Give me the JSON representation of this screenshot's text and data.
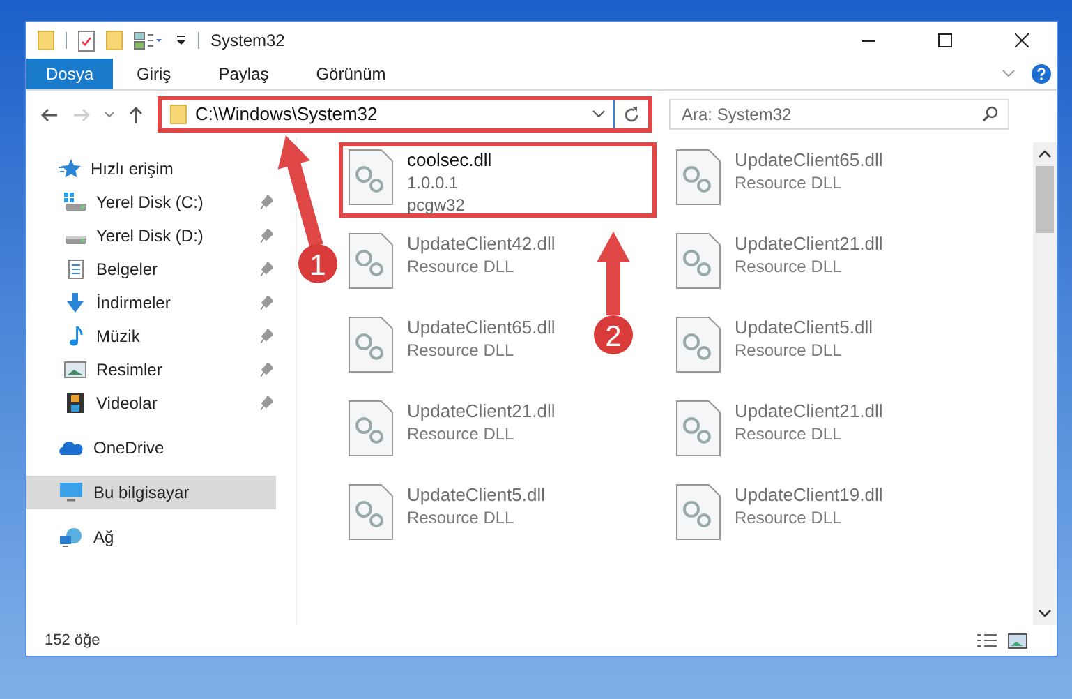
{
  "window": {
    "title": "System32"
  },
  "ribbon": {
    "tabs": [
      {
        "label": "Dosya",
        "selected": true
      },
      {
        "label": "Giriş",
        "selected": false
      },
      {
        "label": "Paylaş",
        "selected": false
      },
      {
        "label": "Görünüm",
        "selected": false
      }
    ]
  },
  "address_bar": {
    "path": "C:\\Windows\\System32",
    "highlighted": true
  },
  "search": {
    "placeholder": "Ara: System32"
  },
  "sidebar": {
    "items": [
      {
        "label": "Hızlı erişim",
        "kind": "star",
        "selected": false,
        "children": [
          {
            "label": "Yerel Disk (C:)",
            "kind": "system-drive",
            "pinned": true,
            "selected": false
          },
          {
            "label": "Yerel Disk (D:)",
            "kind": "drive",
            "pinned": true,
            "selected": false
          },
          {
            "label": "Belgeler",
            "kind": "document",
            "pinned": true,
            "selected": false
          },
          {
            "label": "İndirmeler",
            "kind": "download",
            "pinned": true,
            "selected": false
          },
          {
            "label": "Müzik",
            "kind": "music",
            "pinned": true,
            "selected": false
          },
          {
            "label": "Resimler",
            "kind": "pictures",
            "pinned": true,
            "selected": false
          },
          {
            "label": "Videolar",
            "kind": "video",
            "pinned": true,
            "selected": false
          }
        ]
      },
      {
        "label": "OneDrive",
        "kind": "cloud",
        "selected": false
      },
      {
        "label": "Bu bilgisayar",
        "kind": "computer",
        "selected": true
      },
      {
        "label": "Ağ",
        "kind": "network",
        "selected": false
      }
    ]
  },
  "files": [
    {
      "name": "coolsec.dll",
      "details": [
        "1.0.0.1",
        "pcgw32"
      ],
      "highlighted": true,
      "blurred": false
    },
    {
      "name": "UpdateClient65.dll",
      "details": [
        "Resource DLL"
      ],
      "highlighted": false,
      "blurred": true
    },
    {
      "name": "UpdateClient42.dll",
      "details": [
        "Resource DLL"
      ],
      "highlighted": false,
      "blurred": true
    },
    {
      "name": "UpdateClient21.dll",
      "details": [
        "Resource DLL"
      ],
      "highlighted": false,
      "blurred": true
    },
    {
      "name": "UpdateClient65.dll",
      "details": [
        "Resource DLL"
      ],
      "highlighted": false,
      "blurred": true
    },
    {
      "name": "UpdateClient5.dll",
      "details": [
        "Resource DLL"
      ],
      "highlighted": false,
      "blurred": true
    },
    {
      "name": "UpdateClient21.dll",
      "details": [
        "Resource DLL"
      ],
      "highlighted": false,
      "blurred": true
    },
    {
      "name": "UpdateClient21.dll",
      "details": [
        "Resource DLL"
      ],
      "highlighted": false,
      "blurred": true
    },
    {
      "name": "UpdateClient5.dll",
      "details": [
        "Resource DLL"
      ],
      "highlighted": false,
      "blurred": true
    },
    {
      "name": "UpdateClient19.dll",
      "details": [
        "Resource DLL"
      ],
      "highlighted": false,
      "blurred": true
    }
  ],
  "status_bar": {
    "item_count": "152 öğe"
  },
  "callouts": [
    "1",
    "2"
  ]
}
